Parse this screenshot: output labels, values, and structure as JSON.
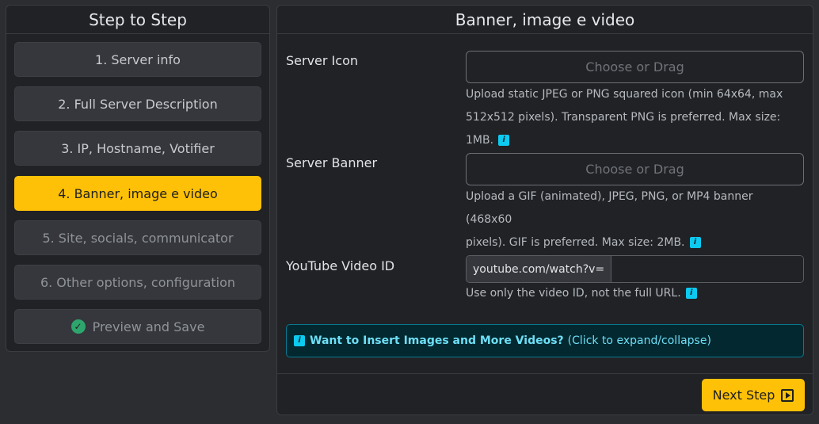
{
  "sidebar": {
    "title": "Step to Step",
    "steps": [
      {
        "label": "1. Server info",
        "state": "normal"
      },
      {
        "label": "2. Full Server Description",
        "state": "normal"
      },
      {
        "label": "3. IP, Hostname, Votifier",
        "state": "normal"
      },
      {
        "label": "4. Banner, image e video",
        "state": "active"
      },
      {
        "label": "5. Site, socials, communicator",
        "state": "disabled"
      },
      {
        "label": "6. Other options, configuration",
        "state": "disabled"
      },
      {
        "label": "Preview and Save",
        "state": "disabled",
        "icon": "check-circle-icon"
      }
    ]
  },
  "panel": {
    "title": "Banner, image e video",
    "server_icon": {
      "label": "Server Icon",
      "button": "Choose or Drag",
      "help_line1": "Upload static JPEG or PNG squared icon (min 64x64, max",
      "help_line2": "512x512 pixels). Transparent PNG is preferred. Max size: 1MB."
    },
    "server_banner": {
      "label": "Server Banner",
      "button": "Choose or Drag",
      "help_line1": "Upload a GIF (animated), JPEG, PNG, or MP4 banner (468x60",
      "help_line2": "pixels). GIF is preferred. Max size: 2MB."
    },
    "youtube": {
      "label": "YouTube Video ID",
      "prefix": "youtube.com/watch?v=",
      "value": "",
      "help": "Use only the video ID, not the full URL."
    },
    "alert": {
      "title": "Want to Insert Images and More Videos?",
      "hint": "(Click to expand/collapse)"
    },
    "next_button": "Next Step",
    "info_glyph": "i"
  },
  "colors": {
    "accent": "#ffc107",
    "info": "#0dcaf0",
    "success": "#2ea56d",
    "background": "#2b2d31",
    "card": "#202226"
  }
}
